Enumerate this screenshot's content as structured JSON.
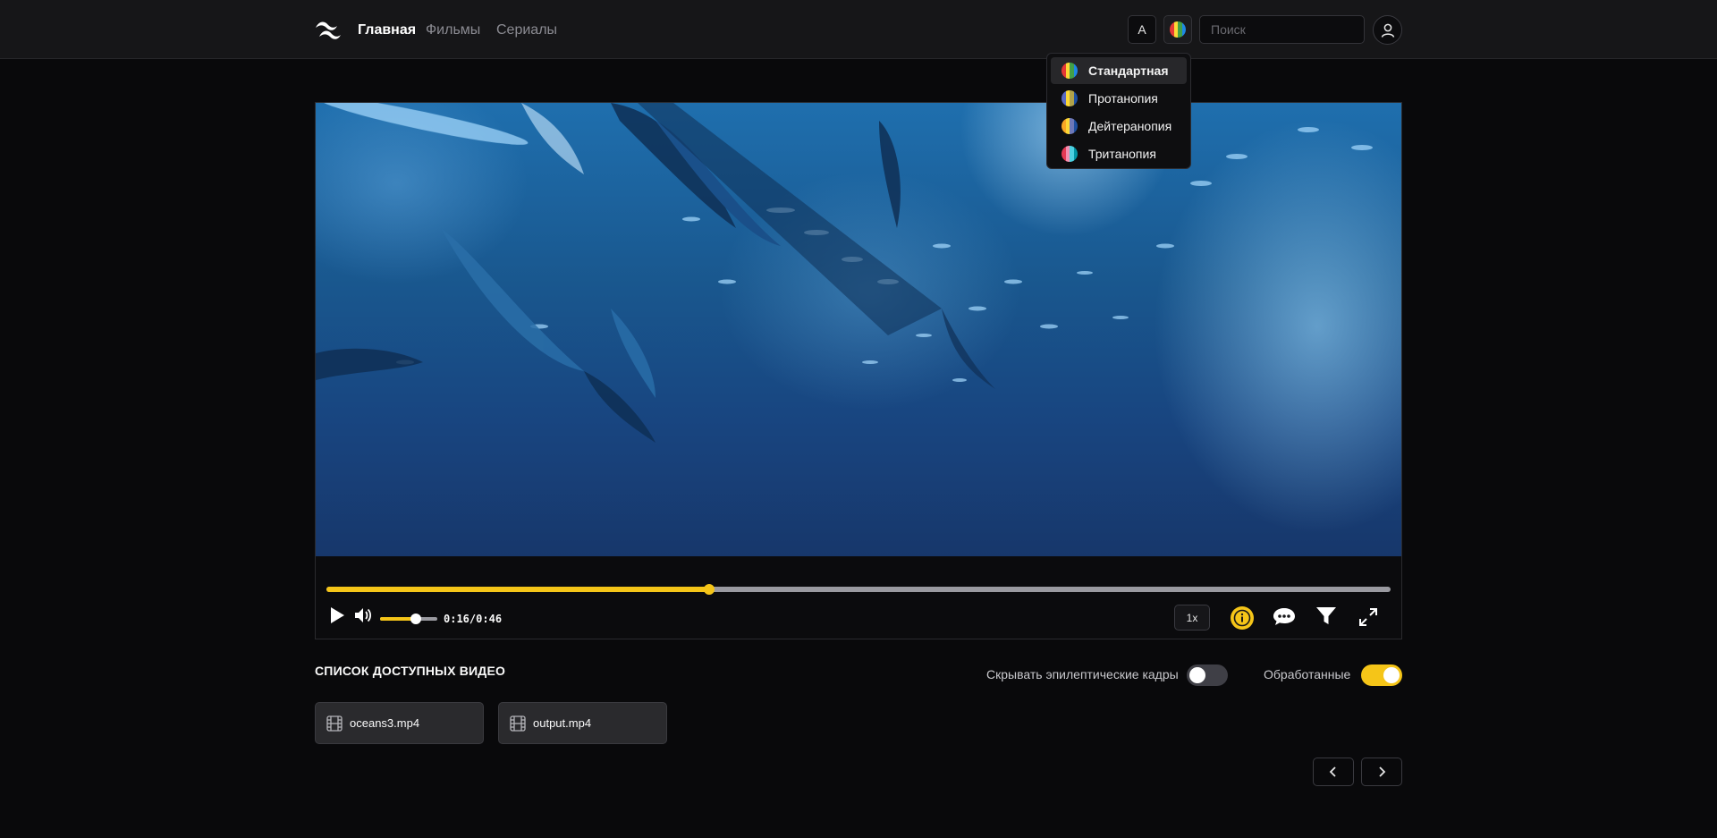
{
  "header": {
    "logo": "tailwind-wave-logo",
    "nav": [
      {
        "label": "Главная",
        "active": true
      },
      {
        "label": "Фильмы",
        "active": false
      },
      {
        "label": "Сериалы",
        "active": false
      }
    ],
    "font_toggle_label": "A",
    "palette_icon": "color-palette-icon",
    "search_placeholder": "Поиск",
    "search_value": "",
    "user_icon": "user-icon"
  },
  "color_mode_menu": {
    "items": [
      {
        "label": "Стандартная",
        "selected": true,
        "swatch": [
          "#e53935",
          "#fdd835",
          "#43a047",
          "#1e88e5"
        ]
      },
      {
        "label": "Протанопия",
        "selected": false,
        "swatch": [
          "#5c6bc0",
          "#fdd835",
          "#b0a24a",
          "#1e4fa0"
        ]
      },
      {
        "label": "Дейтеранопия",
        "selected": false,
        "swatch": [
          "#f9a825",
          "#fdd835",
          "#6d78b8",
          "#1e4fa0"
        ]
      },
      {
        "label": "Тританопия",
        "selected": false,
        "swatch": [
          "#e53955",
          "#f48fb1",
          "#4dd0e1",
          "#0097a7"
        ]
      }
    ]
  },
  "player": {
    "progress": 0.36,
    "current_time": "0:16",
    "separator": "/",
    "duration": "0:46",
    "time_display": "0:16 / 0:46",
    "volume": 0.62,
    "speed": "1x",
    "icons": [
      "play-icon",
      "volume-icon",
      "info-icon",
      "subtitles-icon",
      "filter-icon",
      "fullscreen-icon"
    ]
  },
  "video_list": {
    "title": "СПИСОК ДОСТУПНЫХ ВИДЕО",
    "toggles": [
      {
        "label": "Скрывать эпилептические кадры",
        "on": false
      },
      {
        "label": "Обработанные",
        "on": true
      }
    ],
    "items": [
      {
        "name": "oceans3.mp4",
        "icon": "film-icon"
      },
      {
        "name": "output.mp4",
        "icon": "film-icon"
      }
    ]
  },
  "pagination": {
    "prev_icon": "chevron-left-icon",
    "next_icon": "chevron-right-icon"
  },
  "colors": {
    "accent": "#f5c518",
    "background": "#09090b",
    "header": "#161618"
  }
}
